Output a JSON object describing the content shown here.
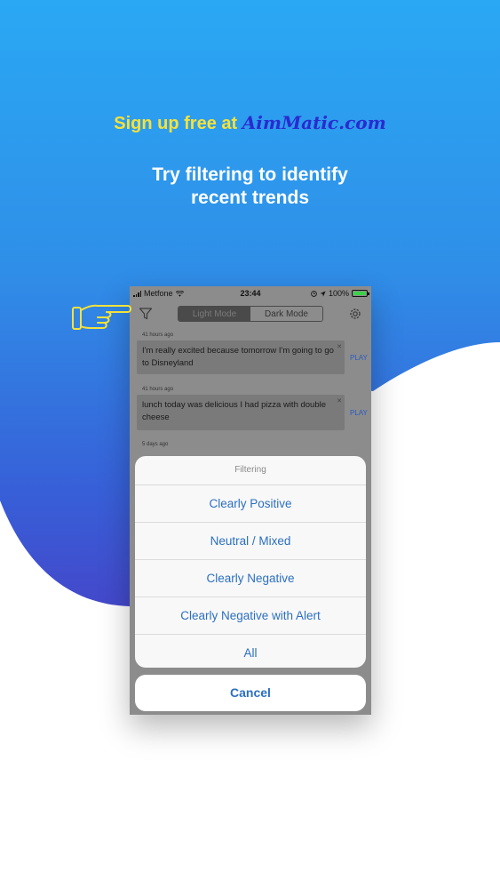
{
  "promo": {
    "prefix": "Sign up free at ",
    "brand": "AimMatic.com"
  },
  "headline": {
    "line1": "Try filtering to identify",
    "line2": "recent trends"
  },
  "status_bar": {
    "carrier": "Metfone",
    "time": "23:44",
    "battery": "100%"
  },
  "toolbar": {
    "modes": [
      "Light Mode",
      "Dark Mode"
    ],
    "active_mode": "Light Mode"
  },
  "messages": [
    {
      "time": "41 hours ago",
      "text": "I'm really excited because tomorrow I'm going to go to Disneyland",
      "action": "PLAY"
    },
    {
      "time": "41 hours ago",
      "text": "lunch today was delicious I had pizza with double cheese",
      "action": "PLAY"
    },
    {
      "time": "5 days ago"
    }
  ],
  "filter_sheet": {
    "title": "Filtering",
    "options": [
      "Clearly Positive",
      "Neutral / Mixed",
      "Clearly Negative",
      "Clearly Negative with Alert",
      "All"
    ],
    "cancel_label": "Cancel"
  },
  "colors": {
    "promo_yellow": "#f5e23a",
    "brand_blue": "#2a2ad0",
    "action_blue": "#2c6fc0",
    "gradient_top": "#2aa8f4",
    "gradient_bottom": "#5a2fb8"
  },
  "icons": [
    "filter-icon",
    "gear-icon",
    "pointing-hand-icon",
    "wifi-icon",
    "location-icon"
  ]
}
